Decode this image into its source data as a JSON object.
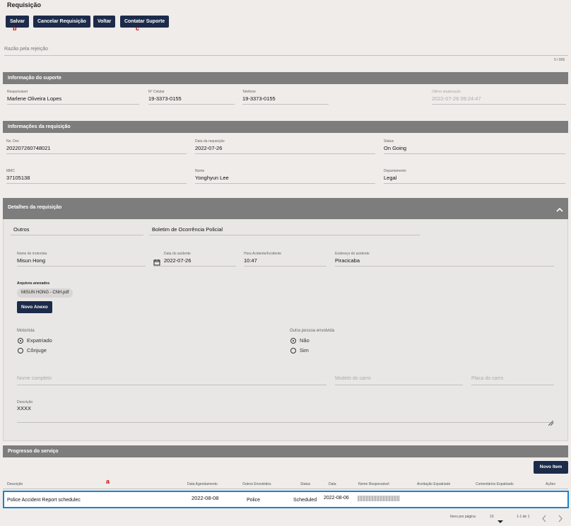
{
  "page": {
    "title": "Requisição"
  },
  "toolbar": {
    "save": "Salvar",
    "cancel": "Cancelar Requisição",
    "back": "Voltar",
    "support": "Contatar Suporte",
    "marker_b": "b",
    "marker_c": "c"
  },
  "rejection": {
    "placeholder": "Razão pela rejeição",
    "counter": "0 / 800"
  },
  "support": {
    "title": "Informação do suporte",
    "responsavel_label": "Responsável",
    "responsavel": "Marlene Oliveira Lopes",
    "celular_label": "N° Celular",
    "celular": "19-3373-0155",
    "telefone_label": "Telefone",
    "telefone": "19-3373-0155",
    "atualizacao_label": "Último atualização",
    "atualizacao": "2022-07-26 09:24:47"
  },
  "request_info": {
    "title": "Informações da requisição",
    "doc_label": "No. Doc",
    "doc": "202207260748021",
    "date_label": "Data da requisição",
    "date": "2022-07-26",
    "status_label": "Status",
    "status": "On Going",
    "mmc_label": "MMC",
    "mmc": "37105138",
    "name_label": "Nome",
    "name": "Yonghyun Lee",
    "dept_label": "Departamento",
    "dept": "Legal"
  },
  "details": {
    "title": "Detalhes da requisição",
    "category": "Outros",
    "subcategory": "Boletim de Ocorrência Policial",
    "driver_label": "Nome do motorista",
    "driver": "Misun Hong",
    "accident_date_label": "Data do acidente",
    "accident_date": "2022-07-26",
    "accident_time_label": "Hora Acidente/Incidente",
    "accident_time": "10:47",
    "address_label": "Endereço do acidente",
    "address": "Piracicaba",
    "attachments_label": "Arquivos anexados",
    "attachment": "MISUN HONG - CNH.pdf",
    "new_attachment": "Novo Anexo",
    "motorista_label": "Motorista",
    "opt_expatriado": "Expatriado",
    "opt_conjuge": "Cônjuge",
    "other_label": "Outra pessoa envolvida",
    "opt_nao": "Não",
    "opt_sim": "Sim",
    "fullname_ph": "Nome completo",
    "car_model_ph": "Modelo do carro",
    "plate_ph": "Placa do carro",
    "desc_label": "Descrição",
    "desc": "XXXX"
  },
  "progress": {
    "title": "Progresso do serviço",
    "new_item": "Novo Item",
    "marker_a": "a",
    "columns": [
      "Descrição",
      "Data Agendamento",
      "Outros Envolvidos",
      "Status",
      "Data",
      "Nome Responsável",
      "Aceitação Expatriado",
      "Comentários Expatriado",
      "Ações"
    ],
    "row": {
      "desc": "Police Accident Report schedulec",
      "schedule": "2022-08-08",
      "others": "Police",
      "status": "Scheduled",
      "date": "2022-08-06"
    },
    "items_per_page_label": "Itens por página",
    "items_per_page": "10",
    "range": "1-1 de 1"
  },
  "colors": {
    "primary": "#1c2b4a",
    "section": "#7d7d7d",
    "highlight": "#1a84c7",
    "background": "#efecea"
  }
}
